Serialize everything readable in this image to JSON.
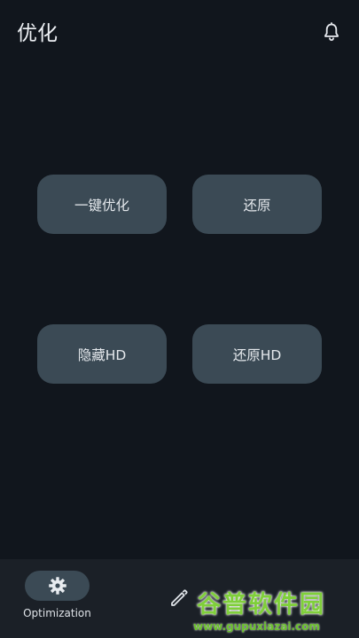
{
  "appbar": {
    "title": "优化"
  },
  "actions": {
    "one_click_optimize": "一键优化",
    "restore": "还原",
    "hide_hd": "隐藏HD",
    "restore_hd": "还原HD"
  },
  "bottom_nav": {
    "items": [
      {
        "label": "Optimization",
        "icon": "gear-icon",
        "selected": true
      },
      {
        "label": "",
        "icon": "pencil-icon",
        "selected": false
      }
    ]
  },
  "watermark": {
    "name": "谷普软件园",
    "url": "www.gupuxiazai.com"
  },
  "colors": {
    "background": "#11161d",
    "button": "#3b4a55",
    "navbar": "#1b2027",
    "watermark_green": "#7fcf3a"
  }
}
